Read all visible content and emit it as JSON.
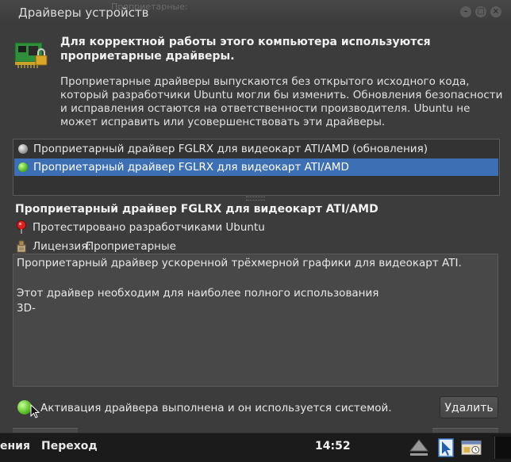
{
  "window": {
    "title": "Драйверы устройств",
    "ghost_text": "Проприетарные:"
  },
  "header": {
    "title": "Для корректной работы этого компьютера используются проприетарные драйверы.",
    "description": "Проприетарные драйверы выпускаются без открытого исходного кода, который разработчики Ubuntu могли бы изменить. Обновления безопасности и исправления остаются на ответственности производителя. Ubuntu не может исправить или усовершенствовать эти драйверы."
  },
  "driver_list": [
    {
      "label": "Проприетарный драйвер FGLRX для видеокарт ATI/AMD (обновления)",
      "status": "inactive",
      "selected": false
    },
    {
      "label": "Проприетарный драйвер FGLRX для видеокарт ATI/AMD",
      "status": "active",
      "selected": true
    }
  ],
  "details": {
    "name": "Проприетарный драйвер FGLRX для видеокарт ATI/AMD",
    "tested": "Протестировано разработчиками Ubuntu",
    "license_label": "Лицензия:",
    "license_value": "Проприетарные",
    "description_line1": "Проприетарный драйвер ускоренной трёхмерной графики для видеокарт ATI.",
    "description_line2": "Этот драйвер необходим для наиболее полного использования",
    "description_line3": "3D-"
  },
  "status": {
    "text": "Активация драйвера выполнена и он используется системой.",
    "remove_label": "Удалить"
  },
  "taskbar": {
    "menu_left": "ения",
    "menu_go": "Переход",
    "clock": "14:52"
  },
  "colors": {
    "selection": "#3d6fb5",
    "window_bg": "#3c3c3c",
    "active_status": "#5fc22a"
  },
  "icons": {
    "header": "hardware-card-icon",
    "tested": "red-pin-icon",
    "license": "license-stamp-icon",
    "tray": [
      "eject-triangle-icon",
      "document-icon",
      "window-list-icon"
    ]
  }
}
